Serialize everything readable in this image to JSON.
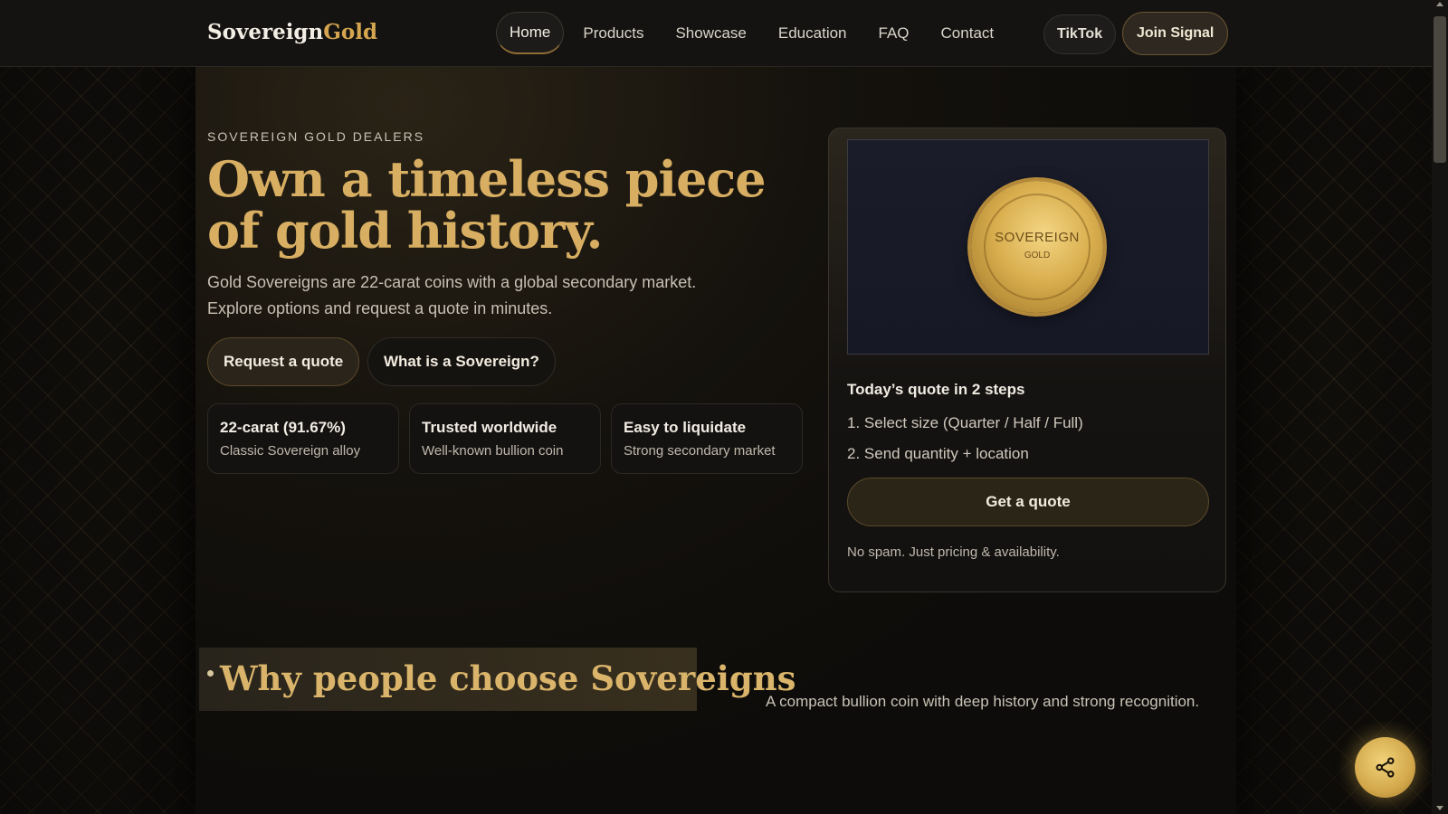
{
  "header": {
    "brand_primary": "Sovereign",
    "brand_accent": "Gold",
    "nav": [
      {
        "label": "Home",
        "active": true
      },
      {
        "label": "Products",
        "active": false
      },
      {
        "label": "Showcase",
        "active": false
      },
      {
        "label": "Education",
        "active": false
      },
      {
        "label": "FAQ",
        "active": false
      },
      {
        "label": "Contact",
        "active": false
      }
    ],
    "tiktok_label": "TikTok",
    "signal_label": "Join Signal"
  },
  "hero": {
    "eyebrow": "SOVEREIGN GOLD DEALERS",
    "title": "Own a timeless piece of gold history.",
    "subtitle": "Gold Sovereigns are 22-carat coins with a global secondary market. Explore options and request a quote in minutes.",
    "primary_button": "Request a quote",
    "secondary_button": "What is a Sovereign?",
    "features": [
      {
        "title": "22-carat (91.67%)",
        "desc": "Classic Sovereign alloy"
      },
      {
        "title": "Trusted worldwide",
        "desc": "Well-known bullion coin"
      },
      {
        "title": "Easy to liquidate",
        "desc": "Strong secondary market"
      }
    ]
  },
  "quote_card": {
    "coin_text": "SOVEREIGN",
    "coin_subtext": "GOLD",
    "title": "Today’s quote in 2 steps",
    "steps": [
      "1. Select size (Quarter / Half / Full)",
      "2. Send quantity + location"
    ],
    "button": "Get a quote",
    "note": "No spam. Just pricing & availability."
  },
  "why": {
    "title": "Why people choose Sovereigns",
    "desc": "A compact bullion coin with deep history and strong recognition."
  },
  "icons": {
    "share": "share-icon"
  },
  "colors": {
    "accent_gold": "#d7ae62",
    "background": "#0c0b0a"
  }
}
